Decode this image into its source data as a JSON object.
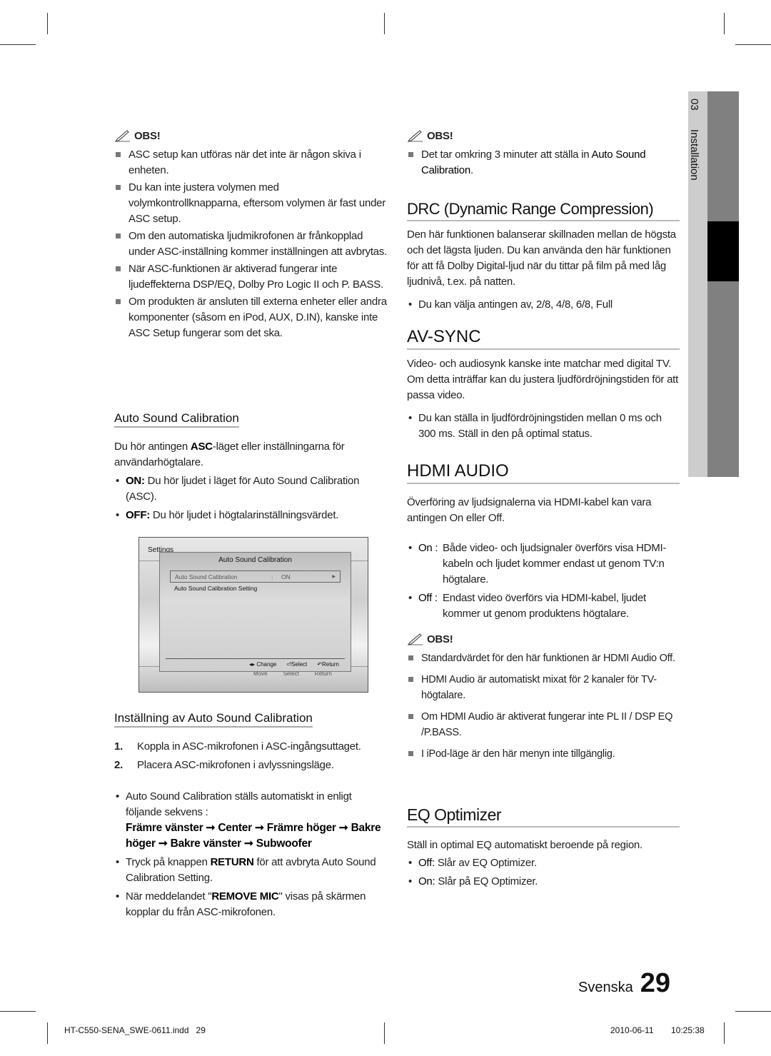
{
  "left": {
    "obs_label": "OBS!",
    "notes": [
      "ASC setup kan utföras när det inte är någon skiva i enheten.",
      "Du kan inte justera volymen med volymkontrollknapparna, eftersom volymen är fast under ASC setup.",
      "Om den automatiska ljudmikrofonen är frånkopplad under ASC-inställning kommer inställningen att avbrytas.",
      "När ASC-funktionen är aktiverad fungerar inte ljudeffekterna DSP/EQ, Dolby Pro Logic II och P. BASS.",
      "Om produkten är ansluten till externa enheter eller andra komponenter (såsom en iPod, AUX, D.IN), kanske inte ASC Setup fungerar som det ska."
    ],
    "asc_heading": "Auto Sound Calibration",
    "asc_intro_pre": "Du hör antingen ",
    "asc_intro_bold": "ASC",
    "asc_intro_post": "-läget eller inställningarna för användarhögtalare.",
    "on_label": "ON:",
    "on_text": " Du hör ljudet i läget för Auto Sound Calibration (ASC).",
    "off_label": "OFF:",
    "off_text": " Du hör ljudet i högtalarinställningsvärdet.",
    "screen": {
      "bg_title": "Settings",
      "dialog_title": "Auto Sound Calibration",
      "row1_label": "Auto Sound Calibration",
      "row1_sep": ":",
      "row1_value": "ON",
      "row2_label": "Auto Sound Calibration Setting",
      "footer": {
        "change": "Change",
        "select": "Select",
        "return": "Return"
      },
      "bg_footer": {
        "move": "Move",
        "select": "Select",
        "return": "Return"
      }
    },
    "setup_heading": "Inställning av Auto Sound Calibration",
    "steps": [
      {
        "n": "1.",
        "text": "Koppla in ASC-mikrofonen i ASC-ingångsuttaget."
      },
      {
        "n": "2.",
        "text": "Placera ASC-mikrofonen i avlyssningsläge."
      }
    ],
    "seq_text": "Auto Sound Calibration ställs automatiskt in enligt följande sekvens :",
    "seq_bold": "Främre vänster ➞ Center ➞ Främre höger ➞ Bakre höger ➞ Bakre vänster ➞ Subwoofer",
    "return_pre": "Tryck på knappen ",
    "return_bold": "RETURN",
    "return_post": " för att avbryta Auto Sound Calibration Setting.",
    "mic_pre": "När meddelandet \"",
    "mic_bold": "REMOVE MIC",
    "mic_post": "\" visas på skärmen kopplar du från ASC-mikrofonen."
  },
  "right": {
    "obs_label": "OBS!",
    "note_pre": "Det tar omkring 3 minuter att ställa in ",
    "note_bold": "Auto Sound Calibration",
    "note_post": ".",
    "drc_heading": "DRC (Dynamic Range Compression)",
    "drc_text": "Den här funktionen balanserar skillnaden mellan de högsta och det lägsta ljuden. Du kan använda den här funktionen för att få Dolby Digital-ljud när du tittar på film på med låg ljudnivå, t.ex. på natten.",
    "drc_bullet": "Du kan välja antingen av, 2/8, 4/8, 6/8, Full",
    "avsync_heading": "AV-SYNC",
    "avsync_text": "Video- och audiosynk kanske inte matchar med digital TV. Om detta inträffar kan du justera ljudfördröjningstiden för att passa video.",
    "avsync_bullet": "Du kan ställa in ljudfördröjningstiden mellan 0 ms och 300 ms. Ställ in den på optimal status.",
    "hdmi_heading": "HDMI AUDIO",
    "hdmi_text": "Överföring av ljudsignalerna via HDMI-kabel kan vara antingen On eller Off.",
    "hdmi_on_label": "On :",
    "hdmi_on_text": " Både video- och ljudsignaler överförs visa HDMI-kabeln och ljudet kommer endast ut genom TV:n högtalare.",
    "hdmi_off_label": "Off :",
    "hdmi_off_text": " Endast video överförs via HDMI-kabel, ljudet kommer ut genom produktens högtalare.",
    "obs2_label": "OBS!",
    "hdmi_notes": [
      "Standardvärdet för den här funktionen är HDMI Audio Off.",
      "HDMI Audio är automatiskt mixat för 2 kanaler för TV-högtalare.",
      "Om HDMI Audio är aktiverat fungerar inte PL II / DSP EQ /P.BASS.",
      "I iPod-läge är den här menyn inte tillgänglig."
    ],
    "eq_heading": "EQ Optimizer",
    "eq_text": "Ställ in optimal EQ automatiskt beroende på region.",
    "eq_off_label": "Off:",
    "eq_off_text": " Slår av EQ Optimizer.",
    "eq_on_label": "On:",
    "eq_on_text": " Slår på EQ Optimizer."
  },
  "side_tab": {
    "chapter": "03",
    "label": "Installation"
  },
  "footer": {
    "language": "Svenska",
    "page": "29",
    "file": "HT-C550-SENA_SWE-0611.indd   29",
    "date": "2010-06-11",
    "time": "10:25:38"
  }
}
